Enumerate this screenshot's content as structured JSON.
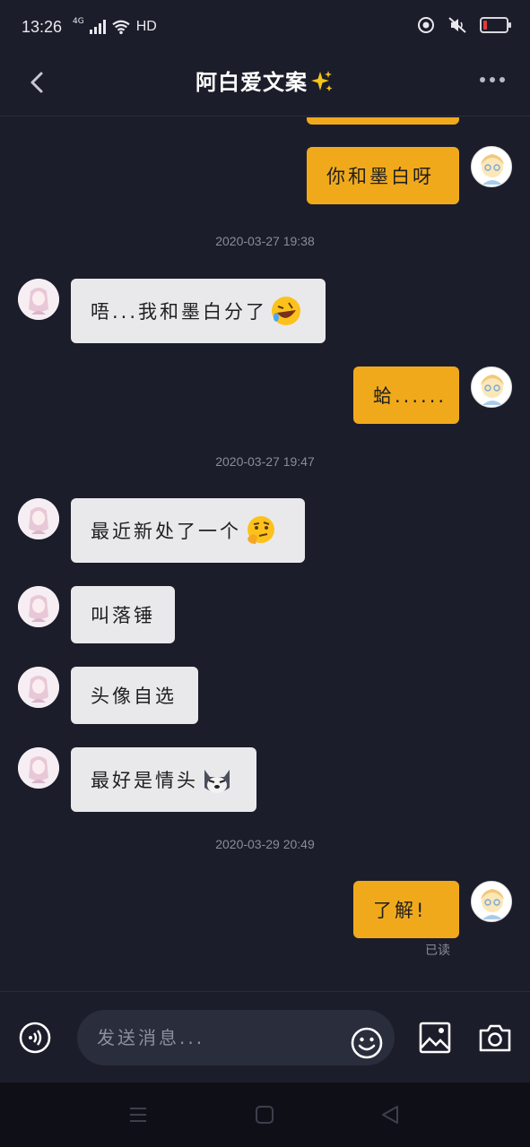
{
  "status_bar": {
    "time": "13:26",
    "network": "4G",
    "hd": "HD"
  },
  "header": {
    "title": "阿白爱文案",
    "title_emoji": "sparkles"
  },
  "messages": [
    {
      "id": "m1",
      "side": "me",
      "text": "你和墨白呀"
    },
    {
      "id": "ts1",
      "type": "timestamp",
      "text": "2020-03-27 19:38"
    },
    {
      "id": "m2",
      "side": "them",
      "text": "唔...我和墨白分了",
      "emoji": "rofl"
    },
    {
      "id": "m3",
      "side": "me",
      "text": "蛤......"
    },
    {
      "id": "ts2",
      "type": "timestamp",
      "text": "2020-03-27 19:47"
    },
    {
      "id": "m4",
      "side": "them",
      "text": "最近新处了一个",
      "emoji": "thinking"
    },
    {
      "id": "m5",
      "side": "them",
      "text": "叫落锤"
    },
    {
      "id": "m6",
      "side": "them",
      "text": "头像自选"
    },
    {
      "id": "m7",
      "side": "them",
      "text": "最好是情头",
      "emoji": "husky"
    },
    {
      "id": "ts3",
      "type": "timestamp",
      "text": "2020-03-29 20:49"
    },
    {
      "id": "m8",
      "side": "me",
      "text": "了解!",
      "read_status": "已读"
    }
  ],
  "input": {
    "placeholder": "发送消息..."
  },
  "colors": {
    "background": "#1b1d2a",
    "my_bubble": "#f1a91c",
    "their_bubble": "#e9e9ec",
    "timestamp": "#8a8c9a"
  }
}
